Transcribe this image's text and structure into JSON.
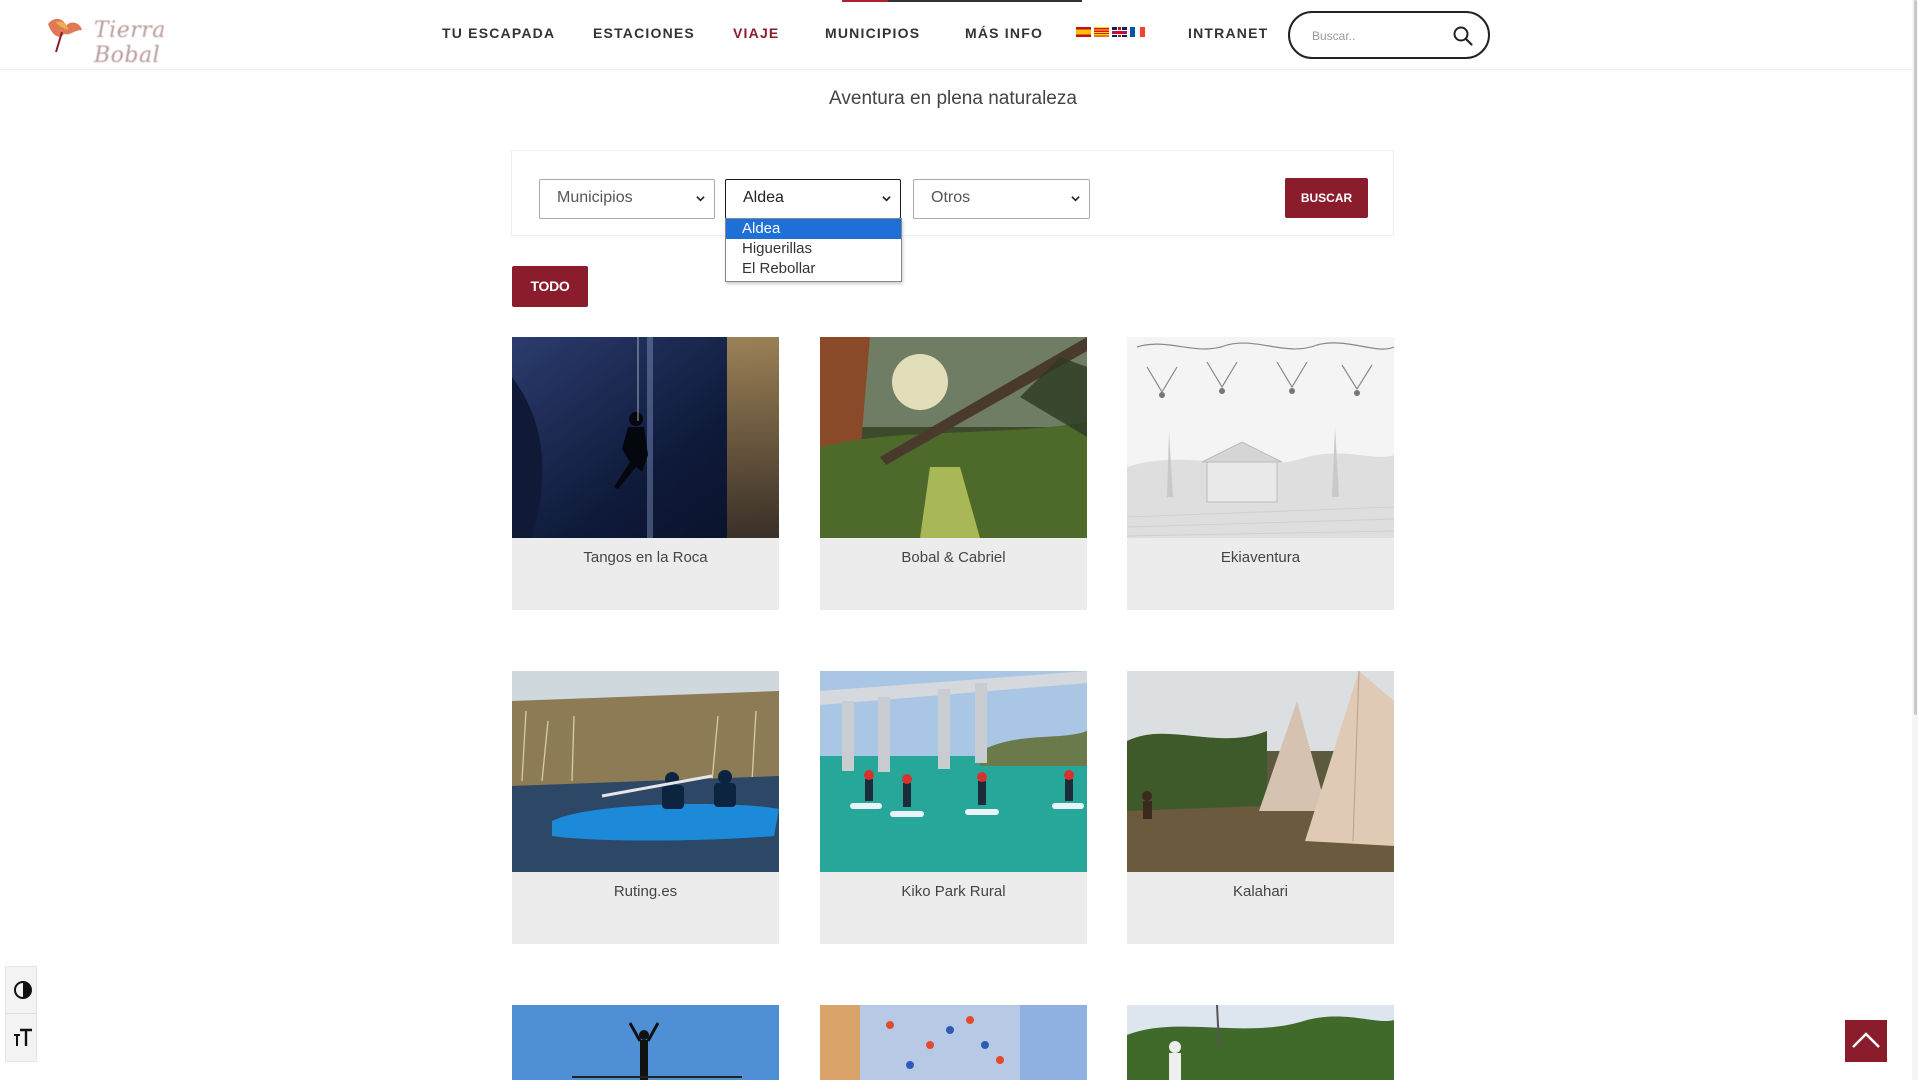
{
  "header": {
    "logo_text": "Tierra Bobal",
    "nav": [
      {
        "label": "TU ESCAPADA",
        "active": false
      },
      {
        "label": "ESTACIONES",
        "active": false
      },
      {
        "label": "VIAJE",
        "active": true
      },
      {
        "label": "MUNICIPIOS",
        "active": false
      },
      {
        "label": "MÁS INFO",
        "active": false
      },
      {
        "label": "INTRANET",
        "active": false
      }
    ],
    "languages": [
      "es",
      "ca",
      "en",
      "fr"
    ],
    "search": {
      "placeholder": "Buscar.."
    }
  },
  "subtitle": "Aventura en plena naturaleza",
  "filters": {
    "municipios": "Municipios",
    "aldea": "Aldea",
    "otros": "Otros",
    "search_button": "BUSCAR",
    "aldea_options": [
      "Aldea",
      "Higuerillas",
      "El Rebollar"
    ],
    "aldea_selected": "Aldea"
  },
  "todo_button": "TODO",
  "cards": [
    {
      "title": "Tangos en la Roca"
    },
    {
      "title": "Bobal & Cabriel"
    },
    {
      "title": "Ekiaventura"
    },
    {
      "title": "Ruting.es"
    },
    {
      "title": "Kiko Park Rural"
    },
    {
      "title": "Kalahari"
    }
  ],
  "colors": {
    "brand": "#8b1c2b",
    "selected_option": "#1e70d8"
  },
  "icons": {
    "search": "search-icon",
    "contrast": "contrast-icon",
    "font_size": "font-size-icon",
    "back_to_top": "chevron-up-icon"
  }
}
